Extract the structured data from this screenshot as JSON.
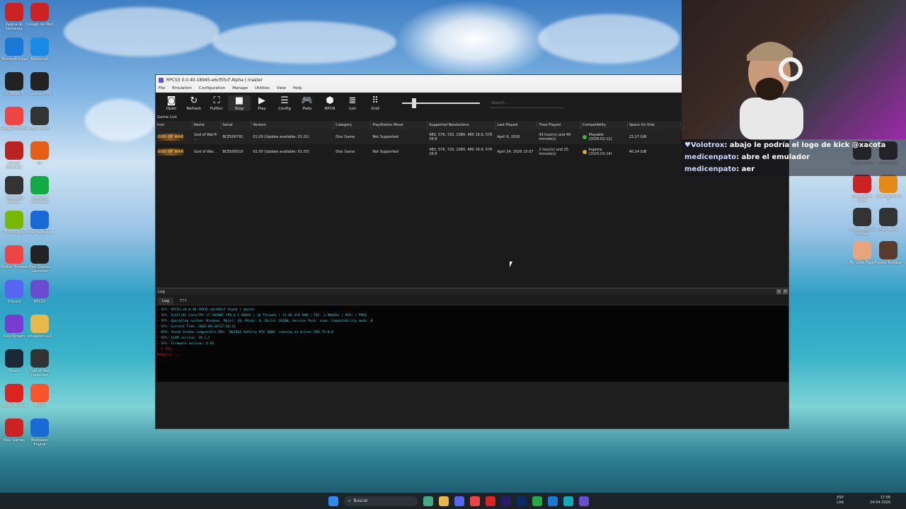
{
  "desktop": {
    "left_icons": [
      {
        "label": "Pagina de Descarga",
        "color": "#c22"
      },
      {
        "label": "Colegio de Mod",
        "color": "#c22"
      },
      {
        "label": "Microsoft Edge",
        "color": "#1a78d6"
      },
      {
        "label": "Battle.net",
        "color": "#1a8ae6"
      },
      {
        "label": "SOMBRA 3",
        "color": "#222"
      },
      {
        "label": "Lossless FPS",
        "color": "#222"
      },
      {
        "label": "Google Chrome",
        "color": "#e44"
      },
      {
        "label": "OBS Studio",
        "color": "#333"
      },
      {
        "label": "RPCS3 Emulator",
        "color": "#b22"
      },
      {
        "label": "EA",
        "color": "#e55e16"
      },
      {
        "label": "Rendering Shader",
        "color": "#333"
      },
      {
        "label": "Overwolf Controller",
        "color": "#1a4"
      },
      {
        "label": "NVIDIA App",
        "color": "#76b900"
      },
      {
        "label": "Intel Wallpaper",
        "color": "#1a6ad6"
      },
      {
        "label": "Mudlet Browser",
        "color": "#e44"
      },
      {
        "label": "Epic Games Launcher",
        "color": "#222"
      },
      {
        "label": "Discord",
        "color": "#5865f2"
      },
      {
        "label": "RPCS3",
        "color": "#6a4bd1"
      },
      {
        "label": "Kick Stream",
        "color": "#7a3bd1"
      },
      {
        "label": "emulador ps3",
        "color": "#e8b84a"
      },
      {
        "label": "Steam",
        "color": "#1b2838"
      },
      {
        "label": "God of War Collection",
        "color": "#333"
      },
      {
        "label": "Adobe Acrobat",
        "color": "#d22"
      },
      {
        "label": "Brave",
        "color": "#fb542b"
      },
      {
        "label": "Epic Games",
        "color": "#c22"
      },
      {
        "label": "Wallpaper Engine",
        "color": "#1a6ad6"
      }
    ],
    "right_icons": [
      {
        "label": "Logo de Kick",
        "color": "#333"
      },
      {
        "label": "Photoshop",
        "color": "#333"
      },
      {
        "label": "Epic Games Store",
        "color": "#c22"
      },
      {
        "label": "Counter-Strike 2",
        "color": "#e58a16"
      },
      {
        "label": "Detroit Become Human",
        "color": "#333"
      },
      {
        "label": "Alan Wake",
        "color": "#333"
      },
      {
        "label": "My Little Piggy",
        "color": "#e8a47a"
      },
      {
        "label": "Freddy Fazbear",
        "color": "#5a3a2a"
      }
    ]
  },
  "window": {
    "title": "RPCS3 0.0.40-18945-e6cf05cf Alpha | master",
    "menu": [
      "File",
      "Emulation",
      "Configuration",
      "Manage",
      "Utilities",
      "View",
      "Help"
    ],
    "toolbar": [
      {
        "label": "Open",
        "icon": "camera-icon",
        "glyph": "◙"
      },
      {
        "label": "Refresh",
        "icon": "refresh-icon",
        "glyph": "↻"
      },
      {
        "label": "FullScr",
        "icon": "fullscreen-icon",
        "glyph": "⛶"
      },
      {
        "label": "Stop",
        "icon": "stop-icon",
        "glyph": "■"
      },
      {
        "label": "Play",
        "icon": "play-icon",
        "glyph": "▶"
      },
      {
        "label": "Config",
        "icon": "config-icon",
        "glyph": "☰"
      },
      {
        "label": "Pads",
        "icon": "gamepad-icon",
        "glyph": "🎮"
      },
      {
        "label": "RPCN",
        "icon": "rpcn-icon",
        "glyph": "⬢"
      },
      {
        "label": "List",
        "icon": "list-icon",
        "glyph": "≣"
      },
      {
        "label": "Grid",
        "icon": "grid-icon",
        "glyph": "⠿"
      }
    ],
    "search_placeholder": "Search...",
    "game_list_label": "Game List",
    "columns": [
      "Icon",
      "Name",
      "Serial",
      "Version",
      "Category",
      "PlayStation Move",
      "Supported Resolutions",
      "Last Played",
      "Time Played",
      "Compatibility",
      "Space On Disk"
    ],
    "games": [
      {
        "icon": "GOD OF WAR",
        "name": "God of War® ...",
        "serial": "BCES00791",
        "version": "01.00 (Update available: 01.01)",
        "category": "Disc Game",
        "move": "Not Supported",
        "resolutions": "480, 576, 720, 1080, 480 16:9, 576 16:9",
        "last_played": "April 9, 2026",
        "time_played": "43 hour(s) and 49 minute(s)",
        "compat_status": "Playable",
        "compat_date": "(2026-02-12)",
        "compat_color": "#2fbf2f",
        "size": "23.27 GiB"
      },
      {
        "icon": "GOD OF WAR",
        "name": "God of War...",
        "serial": "BCES00510",
        "version": "01.00 (Update available: 01.03)",
        "category": "Disc Game",
        "move": "Not Supported",
        "resolutions": "480, 576, 720, 1080, 480 16:9, 576 16:9",
        "last_played": "April 24, 2026 15:07",
        "time_played": "2 hour(s) and 25 minute(s)",
        "compat_status": "Ingame",
        "compat_date": "(2025-03-14)",
        "compat_color": "#e8a316",
        "size": "40.24 GiB"
      }
    ],
    "log_title": "Log",
    "log_tabs": [
      "Log",
      "TTY"
    ],
    "log_lines": [
      {
        "text": "· SYS: RPCS3 v0.0.40-18945-e6cf05cf Alpha | master",
        "color": "#3fd0e0"
      },
      {
        "text": "· SYS: Intel(R) Core(TM) i7-10700F CPU @ 2.90GHz | 16 Threads | 31.86 GiB RAM | TSC: 2.904GHz | AVX+ | FMA3",
        "color": "#3fd0e0"
      },
      {
        "text": "· SYS: Operating system: Windows, Major: 10, Minor: 0, Build: 26200, Service Pack: none, Compatibility mode: 0",
        "color": "#3fd0e0"
      },
      {
        "text": "· SYS: Current Time: 2026-04-24T17:56:22",
        "color": "#3fd0e0"
      },
      {
        "text": "· RSX: Found Vulkan-compatible GPU: 'NVIDIA GeForce RTX 3080' running on driver 595.79.0.0",
        "color": "#3fd0e0"
      },
      {
        "text": "· SYS: LLVM version: 19.1.7",
        "color": "#3fd0e0"
      },
      {
        "text": "· SYS: Firmware version: 4.93",
        "color": "#3fd0e0"
      },
      {
        "text": "· F SYS: ...",
        "color": "#d83030"
      },
      {
        "text": "Details: ...",
        "color": "#d83030"
      }
    ]
  },
  "chat": [
    {
      "user": "♥Volotrox",
      "msg": "abajo le podría el logo de kick @xacota"
    },
    {
      "user": "medicenpato",
      "msg": "abre el emulador"
    },
    {
      "user": "medicenpato",
      "msg": "aer"
    }
  ],
  "taskbar": {
    "search_label": "Buscar",
    "apps": [
      {
        "icon": "widgets-icon",
        "color": "#4a8"
      },
      {
        "icon": "file-explorer-icon",
        "color": "#e8b84a"
      },
      {
        "icon": "discord-taskbar-icon",
        "color": "#5865f2"
      },
      {
        "icon": "chrome-taskbar-icon",
        "color": "#e44"
      },
      {
        "icon": "opera-taskbar-icon",
        "color": "#d22"
      },
      {
        "icon": "premiere-taskbar-icon",
        "color": "#2a1a6a"
      },
      {
        "icon": "photoshop-taskbar-icon",
        "color": "#0a2a6a"
      },
      {
        "icon": "kick-taskbar-icon",
        "color": "#2a4"
      },
      {
        "icon": "store-taskbar-icon",
        "color": "#1a78d6"
      },
      {
        "icon": "edge-taskbar-icon",
        "color": "#1ab"
      },
      {
        "icon": "rpcs3-taskbar-icon",
        "color": "#6a4bd1"
      }
    ],
    "lang_top": "ESP",
    "lang_bottom": "LAA",
    "time": "17:56",
    "date": "24-04-2026"
  }
}
